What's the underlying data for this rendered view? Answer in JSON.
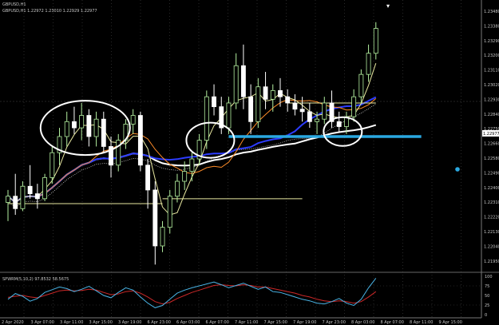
{
  "colors": {
    "background": "#000000",
    "grid": "#444444",
    "bull_candle": "#b4f0a0",
    "bear_candle": "#ffffff",
    "ma_fast": "#e8e8a0",
    "ma_orange": "#ff8c28",
    "ma_blue": "#2c3cff",
    "ma_white": "#ffffff",
    "ma_dotted": "#cfcfcf",
    "level_line": "#e8e8a0",
    "annotation_circle": "#ffffff",
    "highlight_line": "#2aa8e0",
    "osc_main": "#4ab4e6",
    "osc_signal": "#cc2828",
    "price_label_bg": "#ffffff",
    "price_label_text": "#000000"
  },
  "header": {
    "symbol_title": "GBPUSD,H1",
    "ohlc_text": "GBPUSD,H1  1.22972  1.23010  1.22929  1.22977"
  },
  "main_panel": {
    "price_axis": [
      "1.23480",
      "1.23380",
      "1.23290",
      "1.23200",
      "1.23110",
      "1.23020",
      "1.22930",
      "1.22840",
      "1.22750",
      "1.22660",
      "1.22580",
      "1.22490",
      "1.22400",
      "1.22310",
      "1.22220",
      "1.22130",
      "1.22040",
      "1.21950"
    ],
    "current_price": "1.22977",
    "candles": [
      {
        "o": 1.2245,
        "h": 1.2255,
        "l": 1.223,
        "c": 1.225
      },
      {
        "o": 1.225,
        "h": 1.2268,
        "l": 1.2235,
        "c": 1.224
      },
      {
        "o": 1.224,
        "h": 1.2262,
        "l": 1.2238,
        "c": 1.2258
      },
      {
        "o": 1.2258,
        "h": 1.2275,
        "l": 1.2248,
        "c": 1.2252
      },
      {
        "o": 1.2252,
        "h": 1.226,
        "l": 1.224,
        "c": 1.2248
      },
      {
        "o": 1.2248,
        "h": 1.2268,
        "l": 1.2246,
        "c": 1.2265
      },
      {
        "o": 1.2265,
        "h": 1.229,
        "l": 1.226,
        "c": 1.2285
      },
      {
        "o": 1.2285,
        "h": 1.2305,
        "l": 1.2275,
        "c": 1.2298
      },
      {
        "o": 1.2298,
        "h": 1.2318,
        "l": 1.229,
        "c": 1.231
      },
      {
        "o": 1.231,
        "h": 1.2322,
        "l": 1.23,
        "c": 1.2305
      },
      {
        "o": 1.2305,
        "h": 1.2325,
        "l": 1.2295,
        "c": 1.2315
      },
      {
        "o": 1.2315,
        "h": 1.232,
        "l": 1.229,
        "c": 1.2298
      },
      {
        "o": 1.2298,
        "h": 1.2318,
        "l": 1.229,
        "c": 1.2312
      },
      {
        "o": 1.2312,
        "h": 1.2318,
        "l": 1.2285,
        "c": 1.229
      },
      {
        "o": 1.229,
        "h": 1.2298,
        "l": 1.2265,
        "c": 1.2275
      },
      {
        "o": 1.2275,
        "h": 1.23,
        "l": 1.227,
        "c": 1.2295
      },
      {
        "o": 1.2295,
        "h": 1.2312,
        "l": 1.2288,
        "c": 1.2308
      },
      {
        "o": 1.2308,
        "h": 1.232,
        "l": 1.23,
        "c": 1.2315
      },
      {
        "o": 1.2315,
        "h": 1.2318,
        "l": 1.227,
        "c": 1.2275
      },
      {
        "o": 1.2275,
        "h": 1.228,
        "l": 1.224,
        "c": 1.2255
      },
      {
        "o": 1.2255,
        "h": 1.2262,
        "l": 1.2195,
        "c": 1.221
      },
      {
        "o": 1.221,
        "h": 1.223,
        "l": 1.2205,
        "c": 1.2225
      },
      {
        "o": 1.2225,
        "h": 1.2255,
        "l": 1.222,
        "c": 1.225
      },
      {
        "o": 1.225,
        "h": 1.2268,
        "l": 1.2245,
        "c": 1.2262
      },
      {
        "o": 1.2262,
        "h": 1.2278,
        "l": 1.2255,
        "c": 1.227
      },
      {
        "o": 1.227,
        "h": 1.2285,
        "l": 1.2262,
        "c": 1.228
      },
      {
        "o": 1.228,
        "h": 1.23,
        "l": 1.2275,
        "c": 1.2295
      },
      {
        "o": 1.2295,
        "h": 1.2335,
        "l": 1.2288,
        "c": 1.233
      },
      {
        "o": 1.233,
        "h": 1.234,
        "l": 1.2315,
        "c": 1.2322
      },
      {
        "o": 1.2322,
        "h": 1.233,
        "l": 1.23,
        "c": 1.2305
      },
      {
        "o": 1.2305,
        "h": 1.233,
        "l": 1.23,
        "c": 1.2325
      },
      {
        "o": 1.2325,
        "h": 1.2365,
        "l": 1.232,
        "c": 1.2355
      },
      {
        "o": 1.2355,
        "h": 1.2372,
        "l": 1.232,
        "c": 1.233
      },
      {
        "o": 1.233,
        "h": 1.234,
        "l": 1.23,
        "c": 1.231
      },
      {
        "o": 1.231,
        "h": 1.2345,
        "l": 1.2305,
        "c": 1.2338
      },
      {
        "o": 1.2338,
        "h": 1.235,
        "l": 1.232,
        "c": 1.2328
      },
      {
        "o": 1.2328,
        "h": 1.234,
        "l": 1.2318,
        "c": 1.2335
      },
      {
        "o": 1.2335,
        "h": 1.2345,
        "l": 1.2322,
        "c": 1.233
      },
      {
        "o": 1.233,
        "h": 1.2336,
        "l": 1.2318,
        "c": 1.2325
      },
      {
        "o": 1.2325,
        "h": 1.2332,
        "l": 1.2315,
        "c": 1.232
      },
      {
        "o": 1.232,
        "h": 1.233,
        "l": 1.231,
        "c": 1.2318
      },
      {
        "o": 1.2318,
        "h": 1.2325,
        "l": 1.2305,
        "c": 1.231
      },
      {
        "o": 1.231,
        "h": 1.2318,
        "l": 1.23,
        "c": 1.2312
      },
      {
        "o": 1.2312,
        "h": 1.233,
        "l": 1.2308,
        "c": 1.2325
      },
      {
        "o": 1.2325,
        "h": 1.2335,
        "l": 1.2305,
        "c": 1.231
      },
      {
        "o": 1.231,
        "h": 1.2318,
        "l": 1.2302,
        "c": 1.2306
      },
      {
        "o": 1.2306,
        "h": 1.2318,
        "l": 1.23,
        "c": 1.2314
      },
      {
        "o": 1.2314,
        "h": 1.2336,
        "l": 1.231,
        "c": 1.233
      },
      {
        "o": 1.233,
        "h": 1.2352,
        "l": 1.2325,
        "c": 1.2348
      },
      {
        "o": 1.2348,
        "h": 1.2372,
        "l": 1.2342,
        "c": 1.2365
      },
      {
        "o": 1.2365,
        "h": 1.239,
        "l": 1.236,
        "c": 1.2385
      }
    ],
    "levels": [
      {
        "price": 1.2244,
        "from": 0,
        "to": 21
      },
      {
        "price": 1.2248,
        "from": 21,
        "to": 40
      },
      {
        "price": 1.2325,
        "from": 38,
        "to": 50
      }
    ],
    "highlight_level": {
      "price": 1.2298,
      "from": 30,
      "to": 54
    }
  },
  "oscillator": {
    "label": "SPWRM(5,10,2) 97.8532 58.5675",
    "axis": [
      "100",
      "75",
      "50",
      "25",
      "0"
    ],
    "main": [
      40,
      55,
      48,
      35,
      42,
      58,
      65,
      72,
      68,
      60,
      66,
      74,
      62,
      50,
      44,
      58,
      70,
      64,
      46,
      30,
      18,
      24,
      40,
      56,
      64,
      70,
      75,
      80,
      85,
      78,
      70,
      76,
      82,
      74,
      66,
      72,
      60,
      58,
      52,
      46,
      40,
      36,
      30,
      28,
      34,
      42,
      30,
      24,
      40,
      70,
      95
    ],
    "signal": [
      45,
      48,
      50,
      46,
      44,
      50,
      56,
      62,
      64,
      62,
      63,
      66,
      64,
      58,
      52,
      54,
      60,
      62,
      56,
      46,
      34,
      28,
      32,
      42,
      50,
      58,
      64,
      70,
      76,
      78,
      76,
      75,
      78,
      76,
      72,
      72,
      68,
      64,
      60,
      56,
      50,
      46,
      40,
      36,
      34,
      36,
      34,
      30,
      34,
      46,
      60
    ]
  },
  "time_axis": [
    "2 Apr 2020",
    "3 Apr 07:00",
    "3 Apr 11:00",
    "3 Apr 15:00",
    "3 Apr 19:00",
    "6 Apr 23:00",
    "6 Apr 03:00",
    "6 Apr 07:00",
    "7 Apr 11:00",
    "7 Apr 15:00",
    "7 Apr 19:00",
    "7 Apr 23:00",
    "8 Apr 03:00",
    "8 Apr 07:00",
    "8 Apr 11:00",
    "9 Apr 15:00"
  ]
}
